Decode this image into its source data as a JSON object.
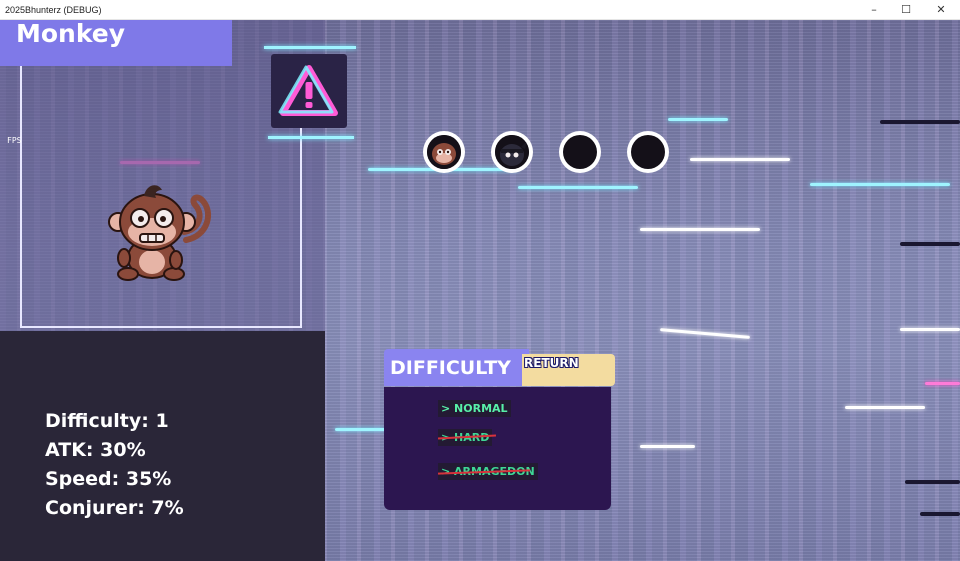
{
  "window": {
    "title": "2025Bhunterz (DEBUG)",
    "minimize": "–",
    "maximize": "☐",
    "close": "✕"
  },
  "character": {
    "name": "Monkey",
    "fps_label": "FPS"
  },
  "stats": [
    {
      "label": "Difficulty: 1"
    },
    {
      "label": "ATK: 30%"
    },
    {
      "label": "Speed: 35%"
    },
    {
      "label": "Conjurer: 7%"
    }
  ],
  "portraits": [
    {
      "name": "monkey",
      "state": "unlocked"
    },
    {
      "name": "ninja",
      "state": "unlocked"
    },
    {
      "name": "locked",
      "state": "locked"
    },
    {
      "name": "locked",
      "state": "locked"
    }
  ],
  "difficulty": {
    "title": "DIFFICULTY",
    "return_label": "RETURN",
    "options": [
      {
        "label": "> NORMAL",
        "locked": false
      },
      {
        "label": "> HARD",
        "locked": true
      },
      {
        "label": "> ARMAGEDON",
        "locked": true
      }
    ]
  },
  "colors": {
    "banner": "#7f79e8",
    "stats_bg": "#2a2638",
    "panel_bg": "#2c1650",
    "option_text": "#58f0a8",
    "return_bg": "#f3dca0",
    "strike": "#d8333c"
  }
}
